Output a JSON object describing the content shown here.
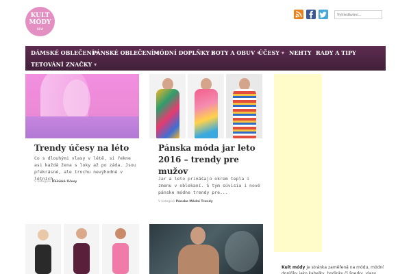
{
  "header": {
    "logo": {
      "line1": "KULT",
      "line2": "MÓDY",
      "tagline": "NEW"
    },
    "social": [
      "rss-icon",
      "facebook-icon",
      "twitter-icon"
    ],
    "search": {
      "placeholder": "Vyhledávání..."
    }
  },
  "nav": {
    "items": [
      {
        "label": "DÁMSKÉ OBLEČENÍ",
        "has_dropdown": true
      },
      {
        "label": "PÁNSKÉ OBLEČENÍ",
        "has_dropdown": true
      },
      {
        "label": "MÓDNÍ DOPLŇKY",
        "has_dropdown": true
      },
      {
        "label": "BOTY A OBUV",
        "has_dropdown": true
      },
      {
        "label": "ÚČESY",
        "has_dropdown": true
      },
      {
        "label": "NEHTY",
        "has_dropdown": false
      },
      {
        "label": "RADY A TIPY",
        "has_dropdown": false
      },
      {
        "label": "TETOVÁNÍ",
        "has_dropdown": false
      },
      {
        "label": "ZNAČKY",
        "has_dropdown": true
      }
    ]
  },
  "posts": [
    {
      "title": "Trendy účesy na léto",
      "excerpt": "Co s dlouhými vlasy v létě, si řekne asi každá žena s loky až po záda. Jsou překrásné, ale trochu nevýhodné v létních...",
      "meta_prefix": "V kategorii",
      "category": "Dámské Účesy"
    },
    {
      "title": "Pánska móda jar leto 2016 – trendy pre mužov",
      "excerpt": "Jar a leto prinášajú okrem tepla i zmenu v oblekaní. S tým súvisia i nové pánske módne trendy pre...",
      "meta_prefix": "V kategorii",
      "category": "Pánske Módni Trendy"
    }
  ],
  "about": {
    "brand": "Kult módy",
    "text": "je stránka zaměřená na módu, módní doplňky jako kabelky, hodinky či šperky, vlasy, boty a"
  },
  "colors": {
    "nav_bg": "#4e2545",
    "logo_pink": "#e38fc2",
    "ad_bg": "#fffcc9"
  }
}
